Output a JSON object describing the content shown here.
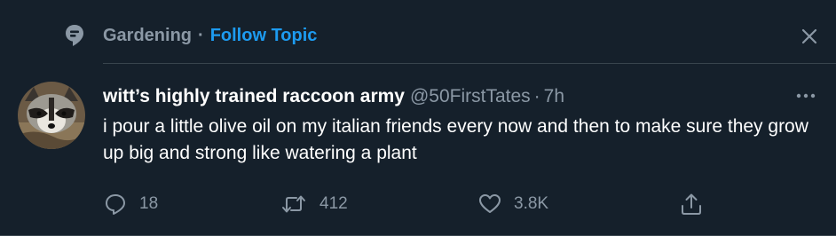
{
  "topic": {
    "name": "Gardening",
    "separator": "·",
    "follow_label": "Follow Topic",
    "icon": "topic-icon",
    "close_icon": "close-icon"
  },
  "tweet": {
    "author_name": "witt’s highly trained raccoon army",
    "handle": "@50FirstTates",
    "separator": "·",
    "time": "7h",
    "text": "i pour a little olive oil on my italian friends every now and then to make sure they grow up big and strong like watering a plant",
    "more_icon": "more-icon"
  },
  "actions": {
    "reply": {
      "icon": "reply-icon",
      "count": "18"
    },
    "retweet": {
      "icon": "retweet-icon",
      "count": "412"
    },
    "like": {
      "icon": "heart-icon",
      "count": "3.8K"
    },
    "share": {
      "icon": "share-icon"
    }
  },
  "colors": {
    "background": "#15202b",
    "accent": "#1d9bf0",
    "secondary_text": "#8b98a5",
    "divider": "#38444d"
  }
}
